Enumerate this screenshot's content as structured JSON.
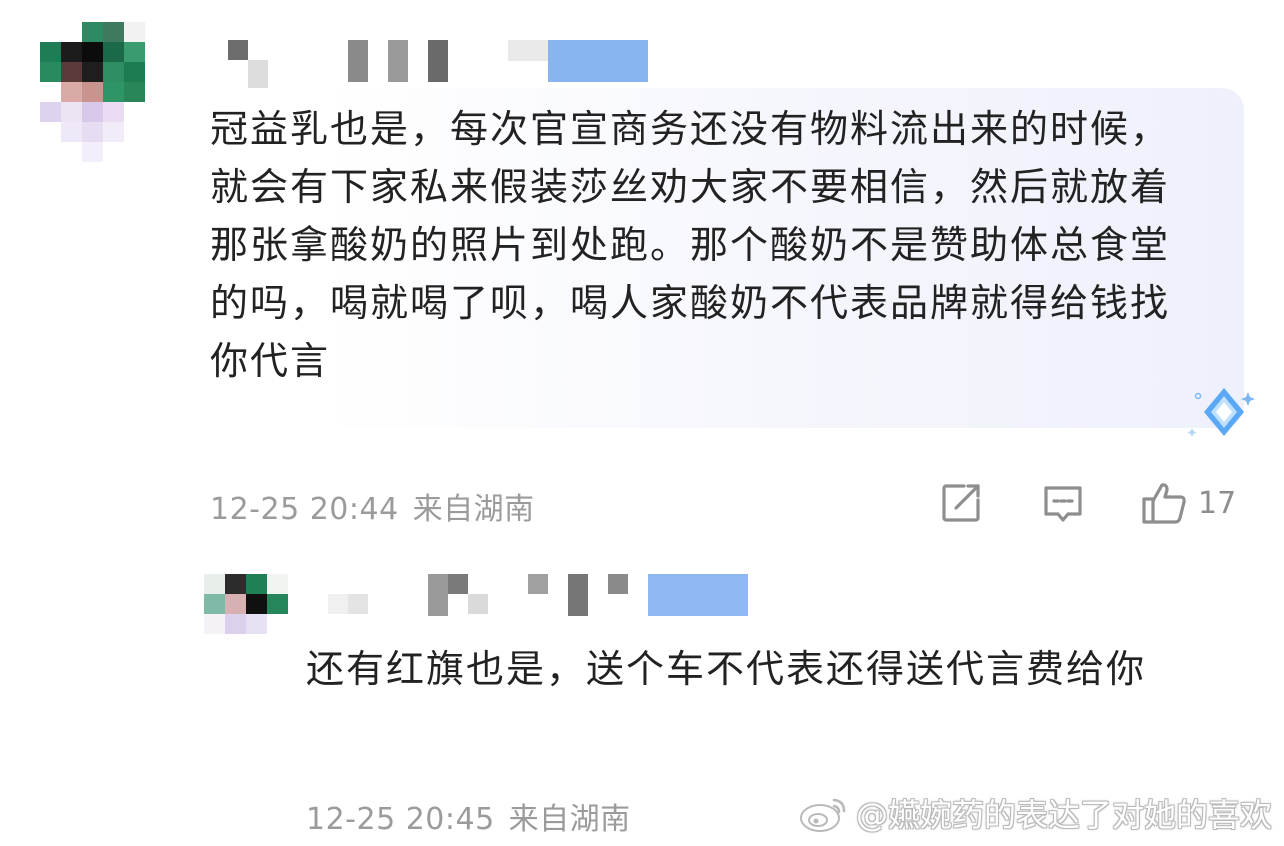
{
  "comment": {
    "text": "冠益乳也是，每次官宣商务还没有物料流出来的时候，就会有下家私来假装莎丝劝大家不要相信，然后就放着那张拿酸奶的照片到处跑。那个酸奶不是赞助体总食堂的吗，喝就喝了呗，喝人家酸奶不代表品牌就得给钱找你代言",
    "time": "12-25 20:44",
    "location": "来自湖南",
    "like_count": "17"
  },
  "reply": {
    "text": "还有红旗也是，送个车不代表还得送代言费给你",
    "time": "12-25 20:45",
    "location": "来自湖南"
  },
  "watermark": {
    "text": "@嬿婉药的表达了对她的喜欢"
  },
  "icons": {
    "share": "share-icon",
    "comment": "comment-icon",
    "like": "thumbs-up-icon",
    "badge": "diamond-badge-icon",
    "weibo": "weibo-logo-icon"
  },
  "colors": {
    "text": "#222222",
    "meta": "#9b9b9b",
    "bubble": "#eef0fb",
    "name_blue": "#8fb6f2",
    "badge_blue": "#5aa8f5"
  }
}
